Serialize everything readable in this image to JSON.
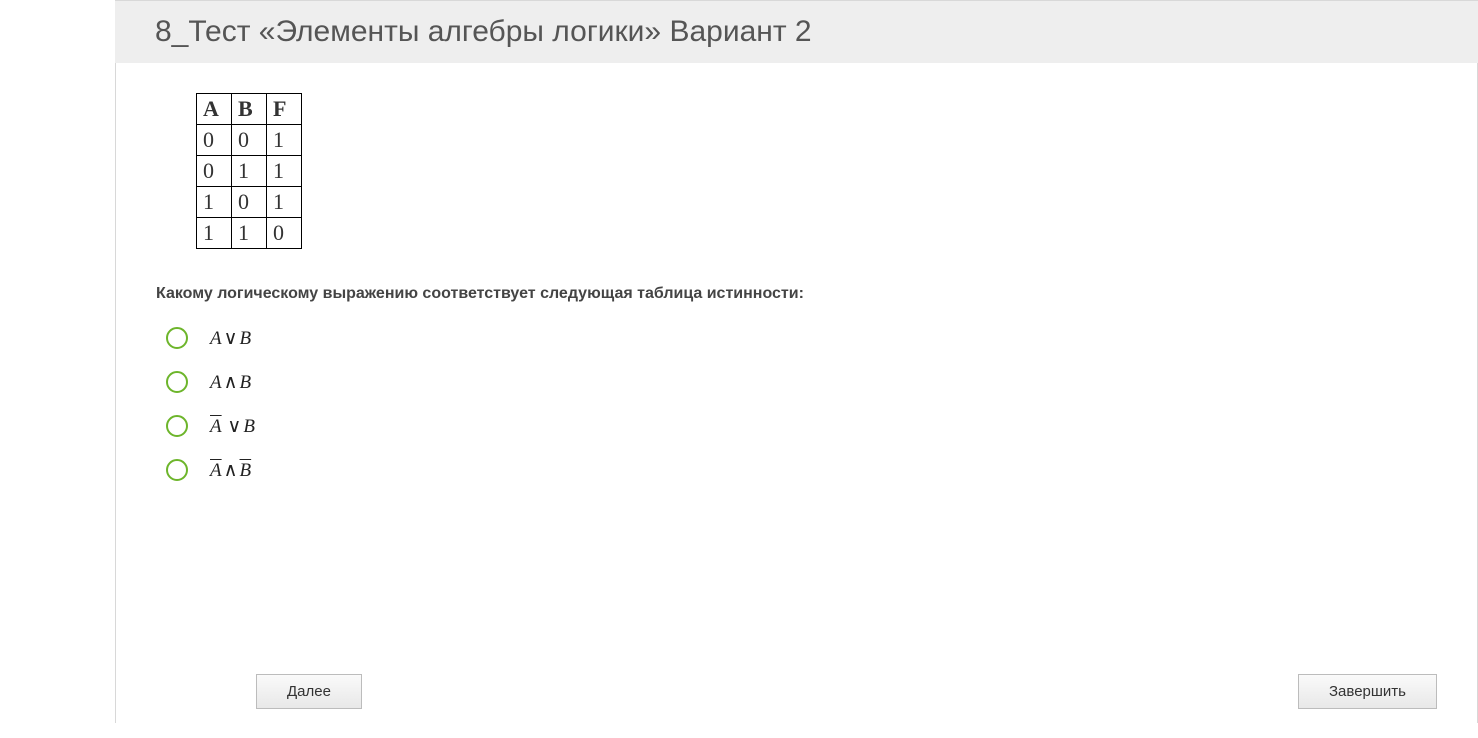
{
  "header": {
    "title": "8_Тест «Элементы алгебры логики» Вариант 2"
  },
  "truth_table": {
    "headers": [
      "A",
      "B",
      "F"
    ],
    "rows": [
      [
        "0",
        "0",
        "1"
      ],
      [
        "0",
        "1",
        "1"
      ],
      [
        "1",
        "0",
        "1"
      ],
      [
        "1",
        "1",
        "0"
      ]
    ]
  },
  "question": {
    "text": "Какому логическому выражению соответствует следующая таблица истинности:"
  },
  "options": [
    {
      "parts": [
        {
          "t": "A"
        },
        {
          "t": " ∨ ",
          "op": true
        },
        {
          "t": "B"
        }
      ]
    },
    {
      "parts": [
        {
          "t": "A"
        },
        {
          "t": " ∧ ",
          "op": true
        },
        {
          "t": "B"
        }
      ]
    },
    {
      "parts": [
        {
          "t": "A",
          "over": true
        },
        {
          "t": "",
          "overgap": true
        },
        {
          "t": " ∨ ",
          "op": true
        },
        {
          "t": "B"
        }
      ]
    },
    {
      "parts": [
        {
          "t": "A ∧ B",
          "over": true,
          "opmix": true
        }
      ]
    }
  ],
  "buttons": {
    "next": "Далее",
    "finish": "Завершить"
  },
  "colors": {
    "accent": "#6db52b",
    "header_bg": "#eeeeee",
    "border": "#d8d8d8"
  }
}
